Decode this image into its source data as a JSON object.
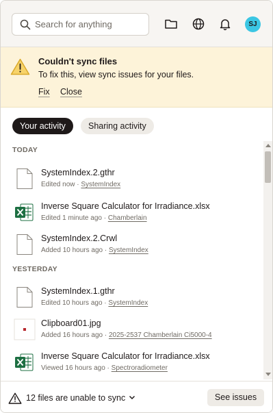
{
  "header": {
    "search_placeholder": "Search for anything",
    "avatar_initials": "SJ",
    "avatar_color": "#3bc6e3"
  },
  "banner": {
    "title": "Couldn't sync files",
    "description": "To fix this, view sync issues for your files.",
    "fix_label": "Fix",
    "close_label": "Close",
    "background": "#fdf3d9",
    "warning_color": "#e8b82a"
  },
  "tabs": [
    {
      "label": "Your activity",
      "active": true
    },
    {
      "label": "Sharing activity",
      "active": false
    }
  ],
  "sections": [
    {
      "label": "TODAY",
      "items": [
        {
          "name": "SystemIndex.2.gthr",
          "action": "Edited now",
          "who": "SystemIndex",
          "icon": "file-icon"
        },
        {
          "name": "Inverse Square Calculator for Irradiance.xlsx",
          "action": "Edited 1 minute ago",
          "who": "Chamberlain",
          "icon": "excel-icon"
        },
        {
          "name": "SystemIndex.2.Crwl",
          "action": "Added 10 hours ago",
          "who": "SystemIndex",
          "icon": "file-icon"
        }
      ]
    },
    {
      "label": "YESTERDAY",
      "items": [
        {
          "name": "SystemIndex.1.gthr",
          "action": "Edited 10 hours ago",
          "who": "SystemIndex",
          "icon": "file-icon"
        },
        {
          "name": "Clipboard01.jpg",
          "action": "Added 16 hours ago",
          "who": "2025-2537 Chamberlain Ci5000-4",
          "icon": "image-thumbnail-icon"
        },
        {
          "name": "Inverse Square Calculator for Irradiance.xlsx",
          "action": "Viewed 16 hours ago",
          "who": "Spectroradiometer",
          "icon": "excel-icon"
        }
      ]
    }
  ],
  "footer": {
    "status_text": "12 files are unable to sync",
    "button_label": "See issues"
  }
}
